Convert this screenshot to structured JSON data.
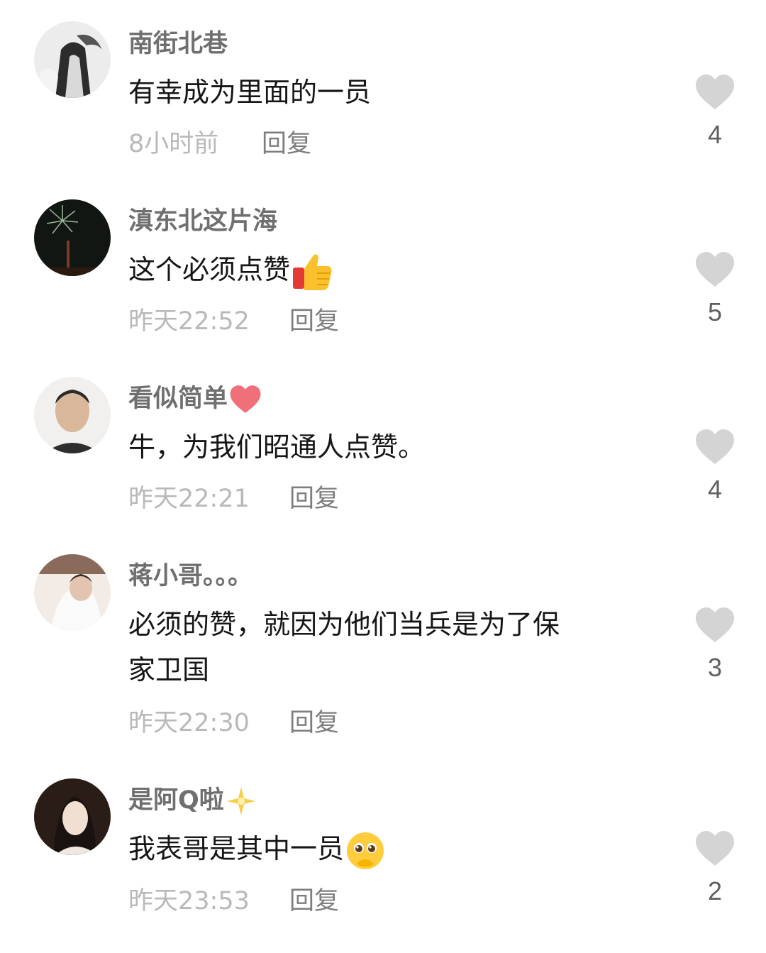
{
  "comments": [
    {
      "username": "南街北巷",
      "username_emoji": "",
      "text_lines": [
        "有幸成为里面的一员"
      ],
      "text_emoji": "",
      "time": "8小时前",
      "reply": "回复",
      "likes": "4"
    },
    {
      "username": "滇东北这片海",
      "username_emoji": "",
      "text_lines": [
        "这个必须点赞"
      ],
      "text_emoji": "thumbs-up",
      "time": "昨天22:52",
      "reply": "回复",
      "likes": "5"
    },
    {
      "username": "看似简单",
      "username_emoji": "red-heart",
      "text_lines": [
        "牛，为我们昭通人点赞。"
      ],
      "text_emoji": "",
      "time": "昨天22:21",
      "reply": "回复",
      "likes": "4"
    },
    {
      "username": "蒋小哥。。。",
      "username_emoji": "",
      "text_lines": [
        "必须的赞，就因为他们当兵是为了保",
        "家卫国"
      ],
      "text_emoji": "",
      "time": "昨天22:30",
      "reply": "回复",
      "likes": "3"
    },
    {
      "username": "是阿Q啦",
      "username_emoji": "sparkle-star",
      "text_lines": [
        "我表哥是其中一员"
      ],
      "text_emoji": "pleading-face",
      "time": "昨天23:53",
      "reply": "回复",
      "likes": "2"
    }
  ],
  "colors": {
    "username": "#6f6f6f",
    "text": "#161616",
    "time": "#b9b9b9",
    "reply": "#7e7e7e",
    "heart": "#d4d4d4",
    "count": "#5f5f5f"
  }
}
